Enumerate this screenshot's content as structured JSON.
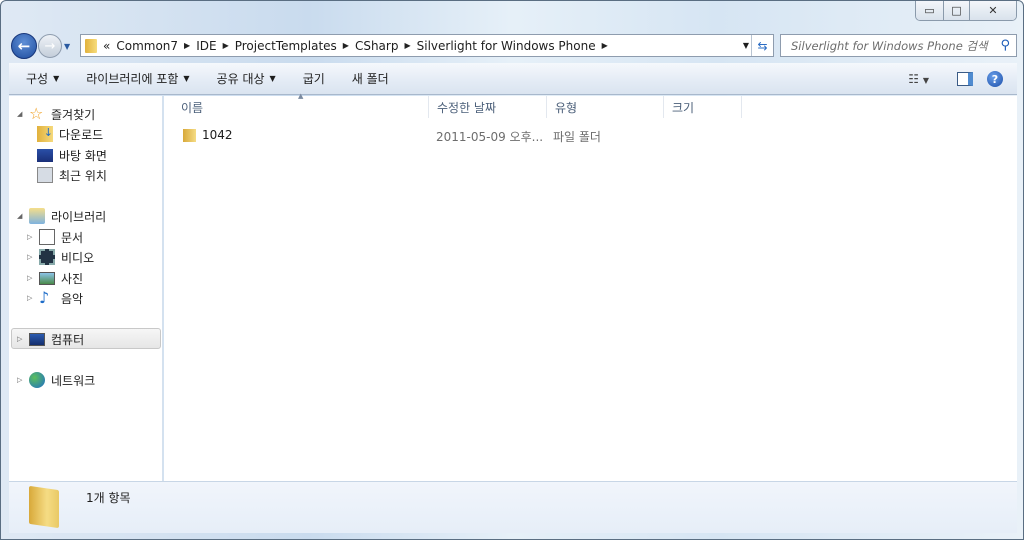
{
  "window": {
    "minimize": "▭",
    "maximize": "□",
    "close": "✕"
  },
  "address": {
    "overflow": "«",
    "crumbs": [
      "Common7",
      "IDE",
      "ProjectTemplates",
      "CSharp",
      "Silverlight for Windows Phone"
    ]
  },
  "search": {
    "placeholder": "Silverlight for Windows Phone 검색"
  },
  "toolbar": {
    "organize": "구성",
    "include_library": "라이브러리에 포함",
    "share": "공유 대상",
    "burn": "굽기",
    "new_folder": "새 폴더"
  },
  "sidebar": {
    "favorites": {
      "label": "즐겨찾기",
      "items": [
        "다운로드",
        "바탕 화면",
        "최근 위치"
      ]
    },
    "libraries": {
      "label": "라이브러리",
      "items": [
        "문서",
        "비디오",
        "사진",
        "음악"
      ]
    },
    "computer": "컴퓨터",
    "network": "네트워크"
  },
  "columns": {
    "name": "이름",
    "modified": "수정한 날짜",
    "type": "유형",
    "size": "크기"
  },
  "files": [
    {
      "name": "1042",
      "modified": "2011-05-09 오후...",
      "type": "파일 폴더",
      "size": ""
    }
  ],
  "status": {
    "count": "1개 항목"
  }
}
